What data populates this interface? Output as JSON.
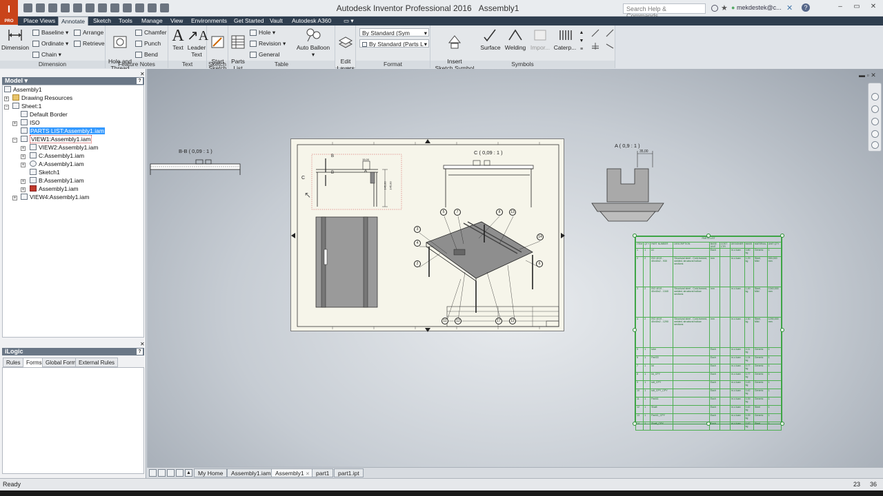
{
  "window": {
    "title": "Autodesk Inventor Professional 2016",
    "doc": "Assembly1",
    "logo": "I",
    "logo_sub": "PRO"
  },
  "search": {
    "placeholder": "Search Help & Commands..."
  },
  "user": {
    "name": "mekdestek@c..."
  },
  "tabs": [
    "Place Views",
    "Annotate",
    "Sketch",
    "Tools",
    "Manage",
    "View",
    "Environments",
    "Get Started",
    "Vault",
    "Autodesk A360"
  ],
  "active_tab": "Annotate",
  "ribbon": {
    "dimension": {
      "big": "Dimension",
      "items": [
        "Baseline",
        "Ordinate",
        "Chain",
        "Arrange",
        "Retrieve"
      ],
      "title": "Dimension"
    },
    "feature_notes": {
      "big": "Hole and\nThread",
      "items": [
        "Chamfer",
        "Punch",
        "Bend"
      ],
      "title": "Feature Notes"
    },
    "text": {
      "items": [
        "Text",
        "Leader\nText"
      ],
      "title": "Text"
    },
    "sketch": {
      "items": [
        "Start\nSketch"
      ],
      "title": "Sketch"
    },
    "table": {
      "big": "Parts\nList",
      "items": [
        "Hole",
        "Revision",
        "General"
      ],
      "title": "Table"
    },
    "auto_balloon": "Auto Balloon",
    "edit_layers": "Edit\nLayers",
    "format": {
      "style1": "By Standard (Sym",
      "style2": "By Standard (Parts L",
      "title": "Format"
    },
    "symbols": {
      "items": [
        "Insert\nSketch Symbol",
        "Surface",
        "Welding",
        "Impor...",
        "Caterp..."
      ],
      "title": "Symbols"
    }
  },
  "model": {
    "header": "Model",
    "nodes": [
      {
        "label": "Assembly1",
        "icon": "drawing-icon"
      },
      {
        "label": "Drawing Resources",
        "icon": "folder-icon"
      },
      {
        "label": "Sheet:1",
        "icon": "sheet-icon"
      },
      {
        "label": "Default Border",
        "icon": "border-icon"
      },
      {
        "label": "ISO",
        "icon": "titleblock-icon"
      },
      {
        "label": "PARTS LIST:Assembly1.iam",
        "icon": "partslist-icon"
      },
      {
        "label": "VIEW1:Assembly1.iam",
        "icon": "view-icon"
      },
      {
        "label": "VIEW2:Assembly1.iam",
        "icon": "view-icon"
      },
      {
        "label": "C:Assembly1.iam",
        "icon": "section-view-icon"
      },
      {
        "label": "A:Assembly1.iam",
        "icon": "detail-view-icon"
      },
      {
        "label": "Sketch1",
        "icon": "sketch-icon"
      },
      {
        "label": "B:Assembly1.iam",
        "icon": "section-view-icon"
      },
      {
        "label": "Assembly1.iam",
        "icon": "assembly-icon"
      },
      {
        "label": "VIEW4:Assembly1.iam",
        "icon": "view-icon"
      }
    ]
  },
  "ilogic": {
    "header": "iLogic",
    "tabs": [
      "Rules",
      "Forms",
      "Global Forms",
      "External Rules"
    ],
    "active": "Forms"
  },
  "views": {
    "b": "B-B ( 0,09 : 1 )",
    "c": "C ( 0,09 : 1 )",
    "a": "A ( 0,9 : 1 )",
    "sec_c": "C",
    "sec_b": "B",
    "sec_a": "A",
    "dim1": "15,00",
    "dim2": "145,00",
    "dim3": "145,00",
    "dimA": "35,00"
  },
  "balloons": [
    "5",
    "7",
    "8",
    "13",
    "3",
    "4",
    "14",
    "2",
    "6",
    "11",
    "12",
    "17",
    "12"
  ],
  "parts_list": {
    "title": "PARTS LIST",
    "columns": [
      "ITEM",
      "QTY",
      "PART NUMBER",
      "DESCRIPTION",
      "BASE UNIT",
      "COST CTR",
      "DESIGNER",
      "MASS",
      "MATERIAL",
      "UNIT QTY"
    ],
    "rows": [
      [
        "1",
        "1",
        "a1",
        "",
        "Each",
        "",
        "m.c.tuan",
        "0,80 kg",
        "Generic",
        "1"
      ],
      [
        "2",
        "2",
        "ISO 4019 - 40x40x2 - 930",
        "Structural steel - Cold-formed, welded, structural hollow sections",
        "mm",
        "",
        "m.c.tuan",
        "1,29 kg",
        "Steel, Mild",
        "930,000 mm"
      ],
      [
        "3",
        "2",
        "ISO 4019 - 40x40x2 - 1340",
        "Structural steel - Cold-formed, welded, structural hollow sections",
        "mm",
        "",
        "m.c.tuan",
        "1,49 kg",
        "Steel, Mild",
        "1340,000 mm"
      ],
      [
        "4",
        "2",
        "ISO 4019 - 40x40x2 - 1290",
        "Structural steel - Cold-formed, welded, structural hollow sections",
        "mm",
        "",
        "m.c.tuan",
        "2,30 kg",
        "Steel, Mild",
        "1290,000 mm"
      ],
      [
        "5",
        "1",
        "tube",
        "",
        "Each",
        "",
        "m.c.tuan",
        "4,11 kg",
        "Generic",
        "1"
      ],
      [
        "6",
        "1",
        "Part33",
        "",
        "Each",
        "",
        "m.c.tuan",
        "1,04 kg",
        "Generic",
        "1"
      ],
      [
        "7",
        "1",
        "lid",
        "",
        "Each",
        "",
        "m.c.tuan",
        "0,77 kg",
        "Generic",
        "1"
      ],
      [
        "8",
        "1",
        "lid_CPY",
        "",
        "Each",
        "",
        "m.c.tuan",
        "0,77 kg",
        "Generic",
        "1"
      ],
      [
        "9",
        "1",
        "sdt_CPY",
        "",
        "Each",
        "",
        "m.c.tuan",
        "0,43 kg",
        "Generic",
        "1"
      ],
      [
        "10",
        "1",
        "sdt_CPY_CPY",
        "",
        "Each",
        "",
        "m.c.tuan",
        "0,42 kg",
        "Generic",
        "1"
      ],
      [
        "11",
        "1",
        "Part41",
        "",
        "Each",
        "",
        "m.c.tuan",
        "0,39 kg",
        "Generic",
        "1"
      ],
      [
        "12",
        "1",
        "Shaft",
        "",
        "Each",
        "",
        "m.c.tuan",
        "0,42 kg",
        "Steel",
        "1"
      ],
      [
        "13",
        "1",
        "Part41_CPY",
        "",
        "Each",
        "",
        "m.c.tuan",
        "0,39 kg",
        "Generic",
        "1"
      ],
      [
        "14",
        "1",
        "Shaft_CPY",
        "",
        "Each",
        "",
        "m.c.tuan",
        "0,42 kg",
        "Steel",
        "1"
      ]
    ]
  },
  "doc_tabs": [
    "My Home",
    "Assembly1.iam",
    "Assembly1",
    "part1",
    "part1.ipt"
  ],
  "active_doc": "Assembly1",
  "status": {
    "text": "Ready",
    "n1": "23",
    "n2": "36"
  }
}
